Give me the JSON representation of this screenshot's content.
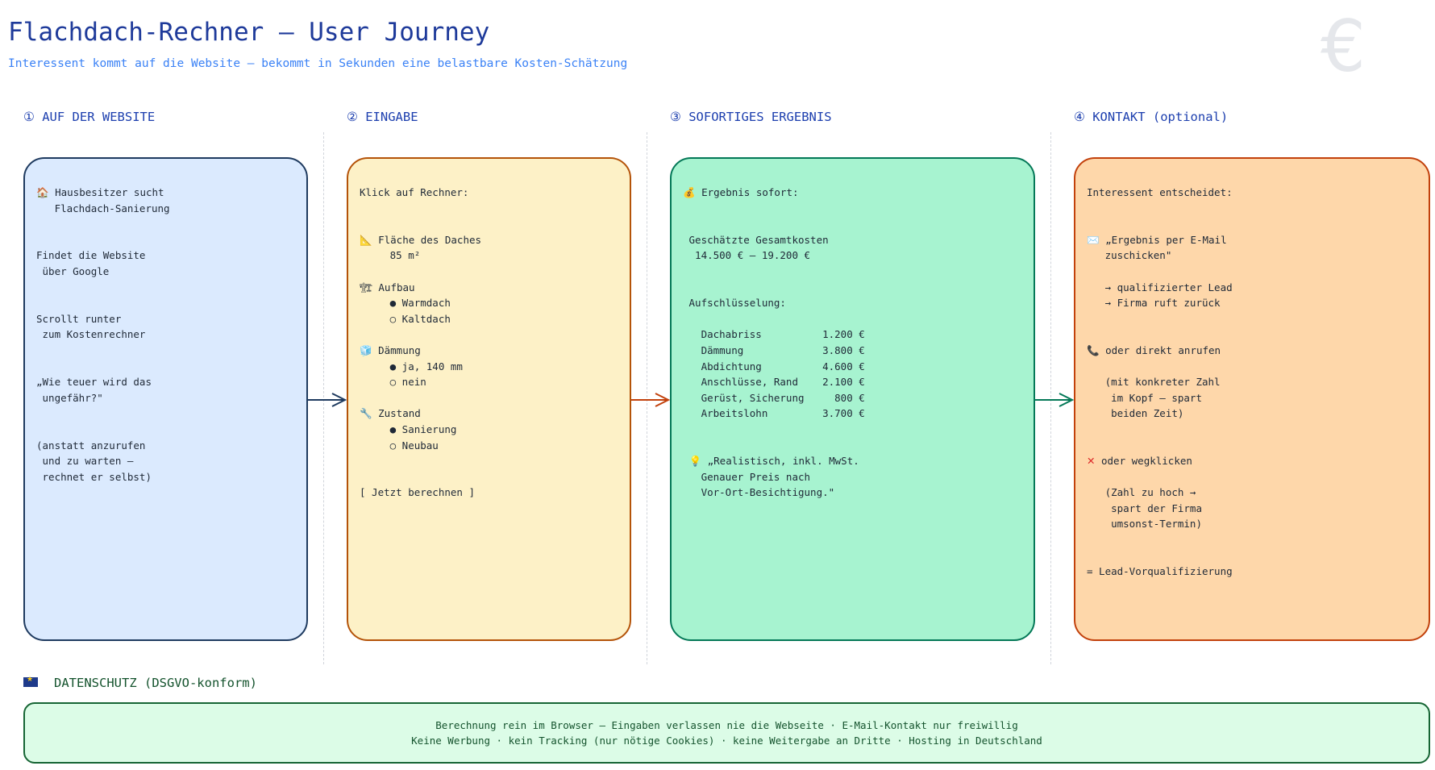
{
  "header": {
    "title": "Flachdach-Rechner — User Journey",
    "subtitle": "Interessent kommt auf die Website — bekommt in Sekunden eine belastbare Kosten-Schätzung",
    "watermark": "€"
  },
  "steps": [
    {
      "header": "① AUF DER WEBSITE",
      "content": "🏠 Hausbesitzer sucht\n   Flachdach-Sanierung\n\n\nFindet die Website\n über Google\n\n\nScrollt runter\n zum Kostenrechner\n\n\n„Wie teuer wird das\n ungefähr?\"\n\n\n(anstatt anzurufen\n und zu warten —\n rechnet er selbst)",
      "color": "#1e3a5f"
    },
    {
      "header": "② EINGABE",
      "content": "Klick auf Rechner:\n\n\n📐 Fläche des Daches\n     85 m²\n\n🏗 Aufbau\n     ● Warmdach\n     ○ Kaltdach\n\n🧊 Dämmung\n     ● ja, 140 mm\n     ○ nein\n\n🔧 Zustand\n     ● Sanierung\n     ○ Neubau\n\n\n[ Jetzt berechnen ]",
      "color": "#b45309"
    },
    {
      "header": "③ SOFORTIGES ERGEBNIS",
      "content": "💰 Ergebnis sofort:\n\n\n Geschätzte Gesamtkosten\n  14.500 € – 19.200 €\n\n\n Aufschlüsselung:\n\n   Dachabriss          1.200 €\n   Dämmung             3.800 €\n   Abdichtung          4.600 €\n   Anschlüsse, Rand    2.100 €\n   Gerüst, Sicherung     800 €\n   Arbeitslohn         3.700 €\n\n\n 💡 „Realistisch, inkl. MwSt.\n   Genauer Preis nach\n   Vor-Ort-Besichtigung.\"",
      "color": "#047857"
    },
    {
      "header": "④ KONTAKT (optional)",
      "content_a": "Interessent entscheidet:\n\n\n✉️ „Ergebnis per E-Mail\n   zuschicken\"\n\n   → qualifizierter Lead\n   → Firma ruft zurück\n\n\n📞 oder direkt anrufen\n\n   (mit konkreter Zahl\n    im Kopf — spart\n    beiden Zeit)\n\n\n",
      "x_mark": "✕",
      "content_b": " oder wegklicken\n\n   (Zahl zu hoch →\n    spart der Firma\n    umsonst-Termin)\n\n\n= Lead-Vorqualifizierung",
      "color": "#c2410c"
    }
  ],
  "privacy": {
    "header": "DATENSCHUTZ (DSGVO-konform)",
    "line1": "Berechnung rein im Browser — Eingaben verlassen nie die Webseite · E-Mail-Kontakt nur freiwillig",
    "line2": "Keine Werbung · kein Tracking (nur nötige Cookies) · keine Weitergabe an Dritte · Hosting in Deutschland"
  }
}
